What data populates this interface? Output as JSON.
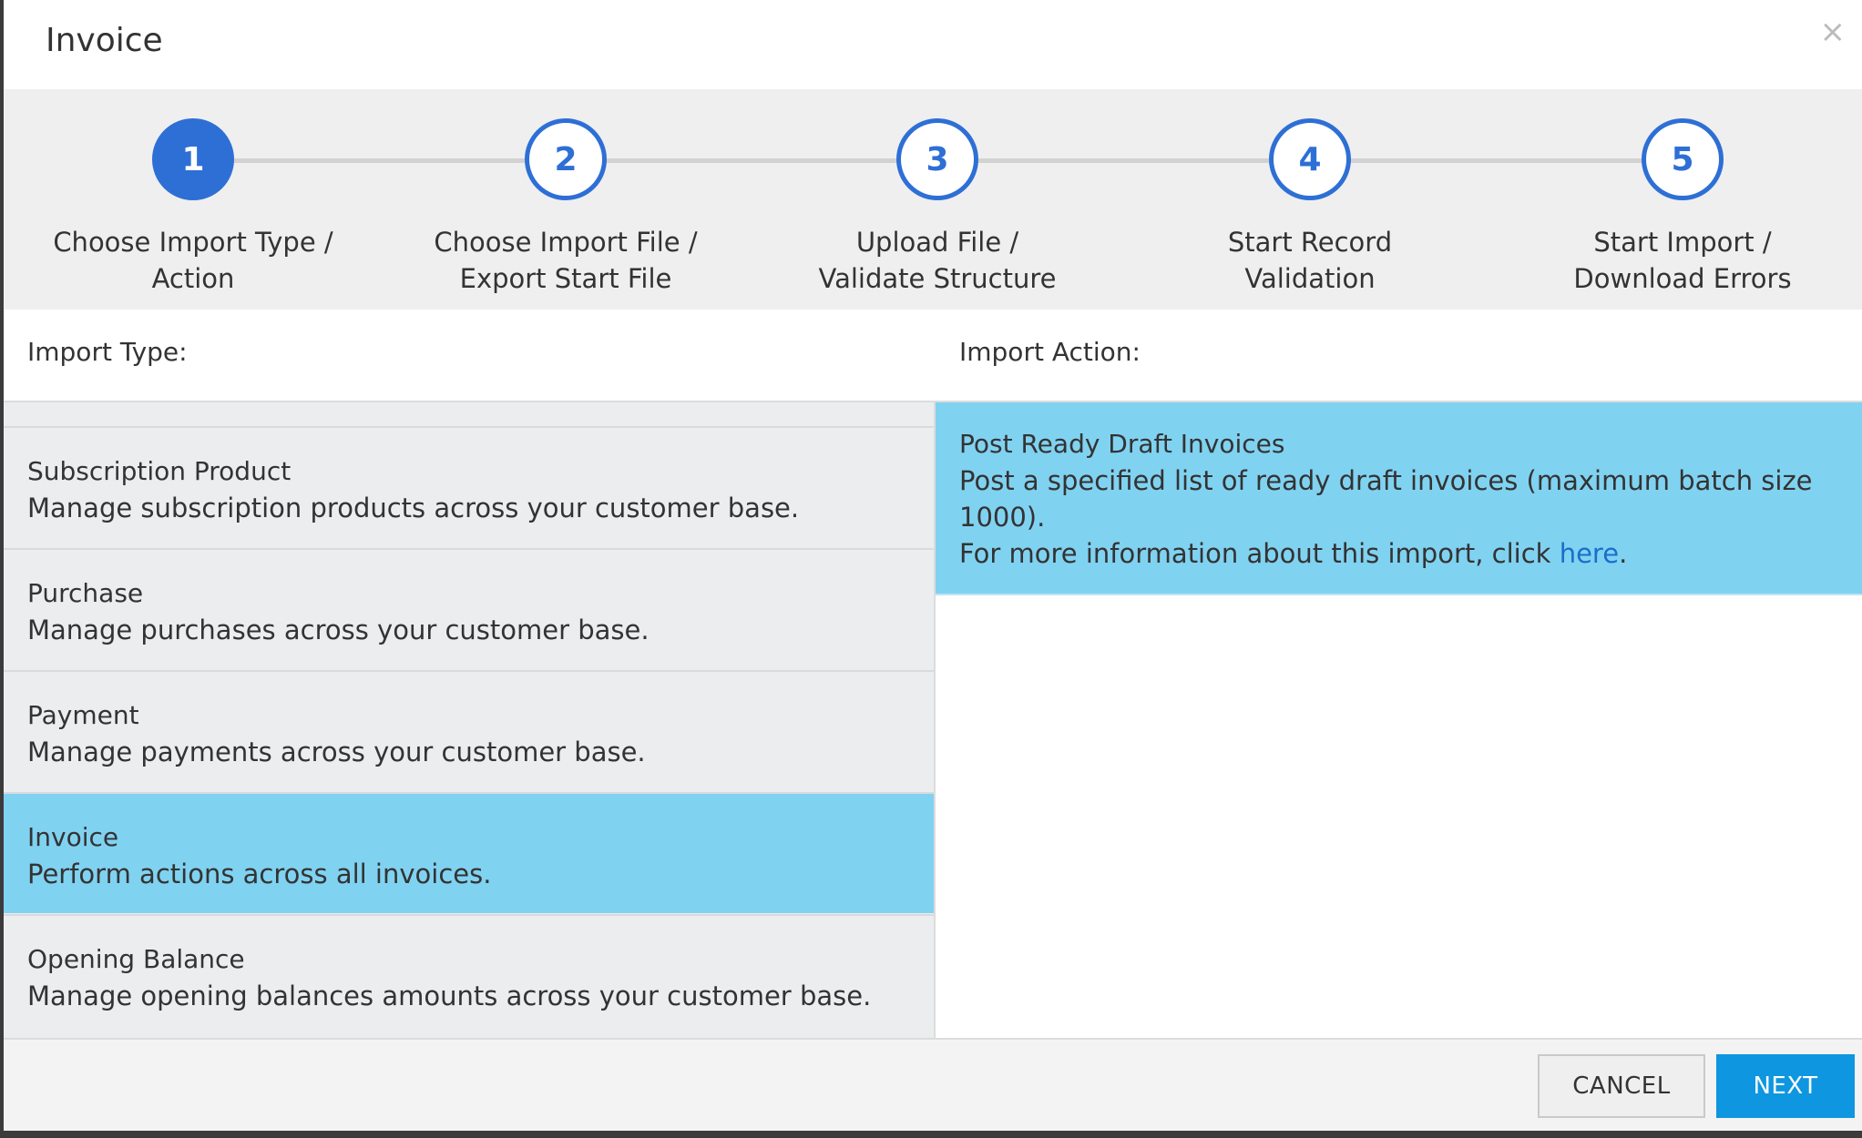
{
  "dialog": {
    "title": "Invoice",
    "close_symbol": "×"
  },
  "steps": [
    {
      "number": "1",
      "line1": "Choose Import Type /",
      "line2": "Action",
      "active": true
    },
    {
      "number": "2",
      "line1": "Choose Import File /",
      "line2": "Export Start File",
      "active": false
    },
    {
      "number": "3",
      "line1": "Upload File /",
      "line2": "Validate Structure",
      "active": false
    },
    {
      "number": "4",
      "line1": "Start Record",
      "line2": "Validation",
      "active": false
    },
    {
      "number": "5",
      "line1": "Start Import /",
      "line2": "Download Errors",
      "active": false
    }
  ],
  "columns": {
    "import_type": "Import Type:",
    "import_action": "Import Action:"
  },
  "import_types": [
    {
      "name": "Subscription Product",
      "description": "Manage subscription products across your customer base.",
      "selected": false
    },
    {
      "name": "Purchase",
      "description": "Manage purchases across your customer base.",
      "selected": false
    },
    {
      "name": "Payment",
      "description": "Manage payments across your customer base.",
      "selected": false
    },
    {
      "name": "Invoice",
      "description": "Perform actions across all invoices.",
      "selected": true
    },
    {
      "name": "Opening Balance",
      "description": "Manage opening balances amounts across your customer base.",
      "selected": false
    }
  ],
  "import_actions": [
    {
      "name": "Post Ready Draft Invoices",
      "description": "Post a specified list of ready draft invoices (maximum batch size 1000).",
      "more_prefix": "For more information about this import, click ",
      "more_link": "here",
      "more_suffix": ".",
      "selected": true
    }
  ],
  "footer": {
    "cancel_label": "CANCEL",
    "next_label": "NEXT"
  },
  "colors": {
    "accent": "#2e6fd6",
    "selected_row": "#80d2f1",
    "primary_button": "#0f96e0",
    "link": "#1a6fc9"
  }
}
